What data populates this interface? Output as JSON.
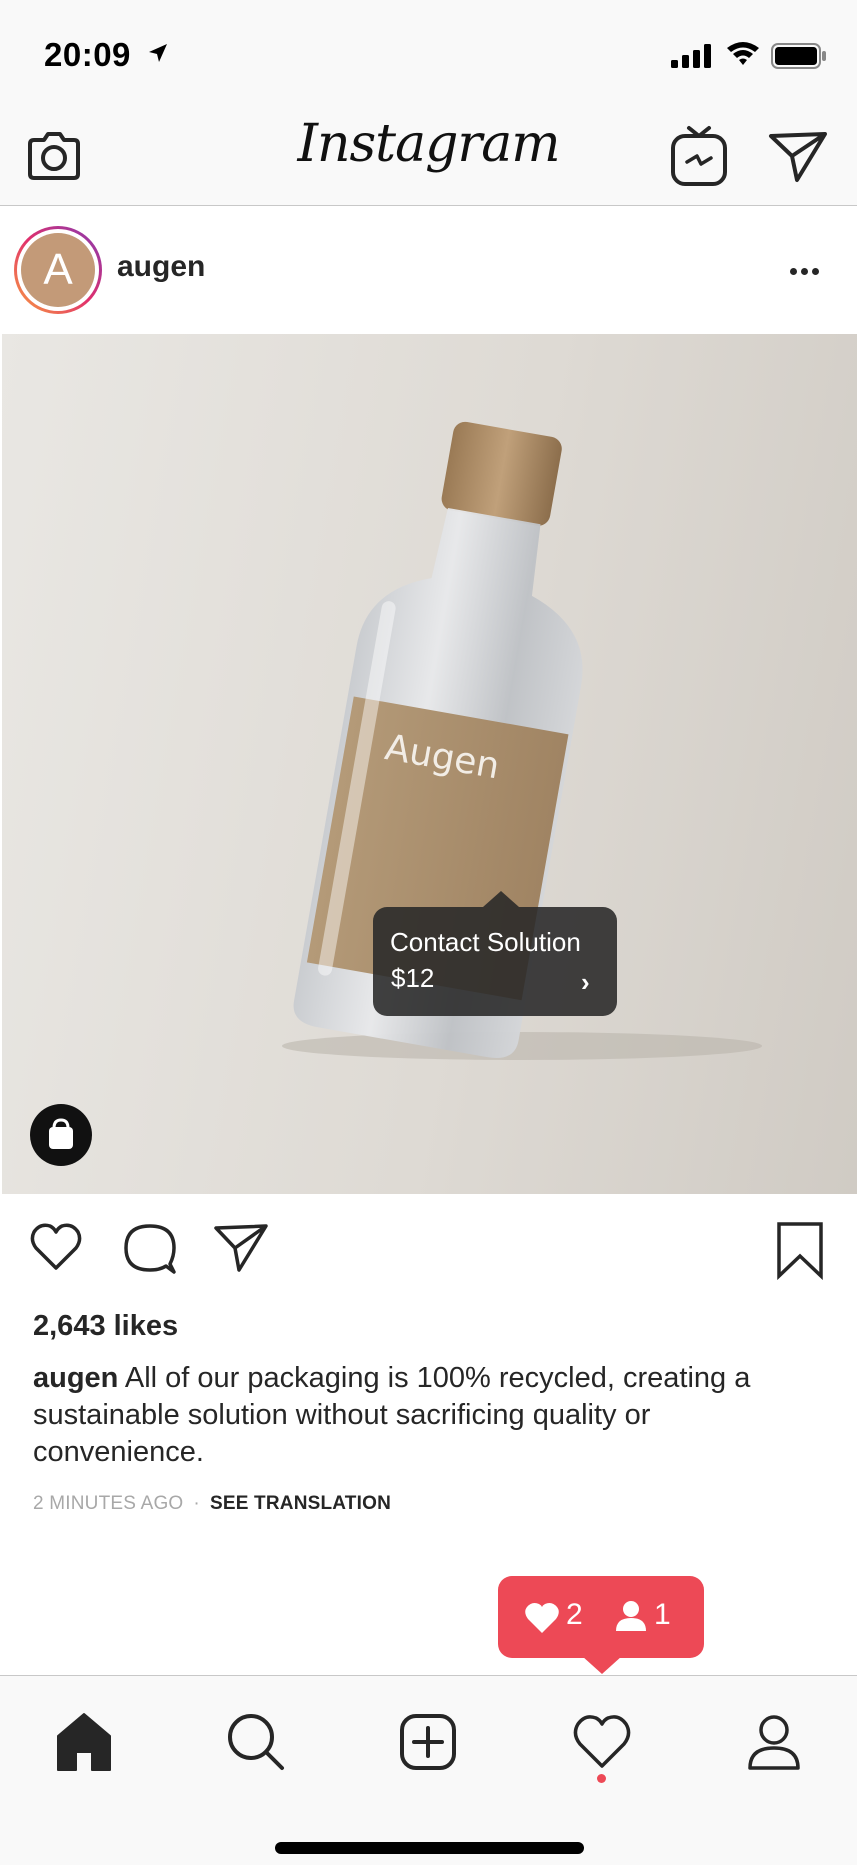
{
  "status_bar": {
    "time": "20:09"
  },
  "nav": {
    "logo": "Instagram"
  },
  "post": {
    "avatar_letter": "A",
    "username": "augen",
    "product_tag": {
      "name": "Contact Solution",
      "price": "$12"
    },
    "bottle_label_brand": "Augen",
    "likes": "2,643 likes",
    "caption_user": "augen",
    "caption_text": "All of our packaging is 100% recycled, creating a sustainable solution without sacrificing quality or convenience.",
    "timestamp": "2 MINUTES AGO",
    "separator": "·",
    "see_translation": "SEE TRANSLATION"
  },
  "notification": {
    "likes_count": "2",
    "follows_count": "1"
  },
  "colors": {
    "notification_red": "#ed4956",
    "text": "#262626",
    "muted": "#a8a8a8",
    "label_kraft": "#a98e6c"
  },
  "icons": {
    "nav": [
      "camera-icon",
      "igtv-icon",
      "direct-message-icon"
    ],
    "actions": [
      "heart-icon",
      "comment-icon",
      "share-icon",
      "bookmark-icon"
    ],
    "tabs": [
      "home-icon",
      "search-icon",
      "add-post-icon",
      "activity-heart-icon",
      "profile-icon"
    ]
  }
}
